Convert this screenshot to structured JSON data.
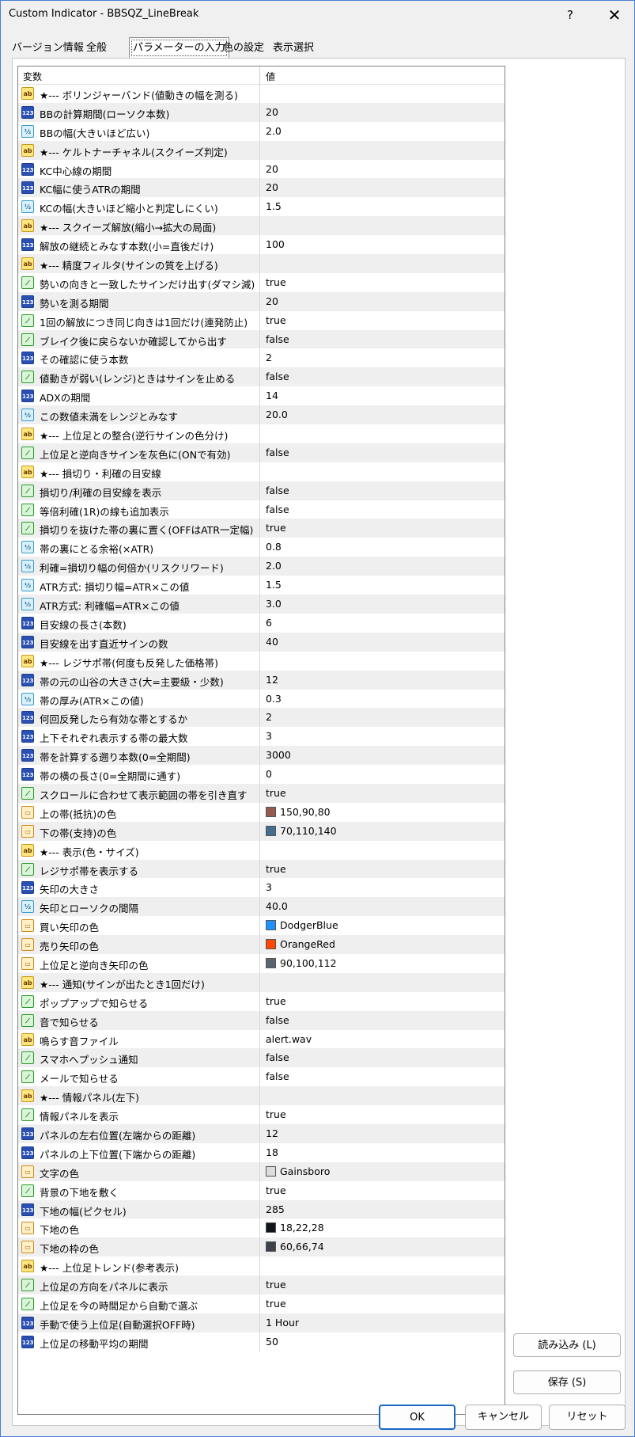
{
  "window": {
    "title": "Custom Indicator - BBSQZ_LineBreak",
    "help": "?",
    "close": "✕"
  },
  "tabs": [
    {
      "label": "バージョン情報"
    },
    {
      "label": "全般"
    },
    {
      "label": "パラメーターの入力"
    },
    {
      "label": "色の設定"
    },
    {
      "label": "表示選択"
    }
  ],
  "grid": {
    "col_variable": "変数",
    "col_value": "値"
  },
  "rows": [
    {
      "icon": "ab",
      "name": "★--- ボリンジャーバンド(値動きの幅を測る)",
      "value": ""
    },
    {
      "icon": "123",
      "name": "BBの計算期間(ローソク本数)",
      "value": "20"
    },
    {
      "icon": "half",
      "name": "BBの幅(大きいほど広い)",
      "value": "2.0"
    },
    {
      "icon": "ab",
      "name": "★--- ケルトナーチャネル(スクイーズ判定)",
      "value": ""
    },
    {
      "icon": "123",
      "name": "KC中心線の期間",
      "value": "20"
    },
    {
      "icon": "123",
      "name": "KC幅に使うATRの期間",
      "value": "20"
    },
    {
      "icon": "half",
      "name": "KCの幅(大きいほど縮小と判定しにくい)",
      "value": "1.5"
    },
    {
      "icon": "ab",
      "name": "★--- スクイーズ解放(縮小→拡大の局面)",
      "value": ""
    },
    {
      "icon": "123",
      "name": "解放の継続とみなす本数(小=直後だけ)",
      "value": "100"
    },
    {
      "icon": "ab",
      "name": "★--- 精度フィルタ(サインの質を上げる)",
      "value": ""
    },
    {
      "icon": "bool",
      "name": "勢いの向きと一致したサインだけ出す(ダマシ減)",
      "value": "true"
    },
    {
      "icon": "123",
      "name": "勢いを測る期間",
      "value": "20"
    },
    {
      "icon": "bool",
      "name": "1回の解放につき同じ向きは1回だけ(連発防止)",
      "value": "true"
    },
    {
      "icon": "bool",
      "name": "ブレイク後に戻らないか確認してから出す",
      "value": "false"
    },
    {
      "icon": "123",
      "name": "その確認に使う本数",
      "value": "2"
    },
    {
      "icon": "bool",
      "name": "値動きが弱い(レンジ)ときはサインを止める",
      "value": "false"
    },
    {
      "icon": "123",
      "name": "ADXの期間",
      "value": "14"
    },
    {
      "icon": "half",
      "name": "この数値未満をレンジとみなす",
      "value": "20.0"
    },
    {
      "icon": "ab",
      "name": "★--- 上位足との整合(逆行サインの色分け)",
      "value": ""
    },
    {
      "icon": "bool",
      "name": "上位足と逆向きサインを灰色に(ONで有効)",
      "value": "false"
    },
    {
      "icon": "ab",
      "name": "★--- 損切り・利確の目安線",
      "value": ""
    },
    {
      "icon": "bool",
      "name": "損切り/利確の目安線を表示",
      "value": "false"
    },
    {
      "icon": "bool",
      "name": "等倍利確(1R)の線も追加表示",
      "value": "false"
    },
    {
      "icon": "bool",
      "name": "損切りを抜けた帯の裏に置く(OFFはATR一定幅)",
      "value": "true"
    },
    {
      "icon": "half",
      "name": "帯の裏にとる余裕(×ATR)",
      "value": "0.8"
    },
    {
      "icon": "half",
      "name": "利確=損切り幅の何倍か(リスクリワード)",
      "value": "2.0"
    },
    {
      "icon": "half",
      "name": "ATR方式: 損切り幅=ATR×この値",
      "value": "1.5"
    },
    {
      "icon": "half",
      "name": "ATR方式: 利確幅=ATR×この値",
      "value": "3.0"
    },
    {
      "icon": "123",
      "name": "目安線の長さ(本数)",
      "value": "6"
    },
    {
      "icon": "123",
      "name": "目安線を出す直近サインの数",
      "value": "40"
    },
    {
      "icon": "ab",
      "name": "★--- レジサポ帯(何度も反発した価格帯)",
      "value": ""
    },
    {
      "icon": "123",
      "name": "帯の元の山谷の大きさ(大=主要級・少数)",
      "value": "12"
    },
    {
      "icon": "half",
      "name": "帯の厚み(ATR×この値)",
      "value": "0.3"
    },
    {
      "icon": "123",
      "name": "何回反発したら有効な帯とするか",
      "value": "2"
    },
    {
      "icon": "123",
      "name": "上下それぞれ表示する帯の最大数",
      "value": "3"
    },
    {
      "icon": "123",
      "name": "帯を計算する遡り本数(0=全期間)",
      "value": "3000"
    },
    {
      "icon": "123",
      "name": "帯の横の長さ(0=全期間に通す)",
      "value": "0"
    },
    {
      "icon": "bool",
      "name": "スクロールに合わせて表示範囲の帯を引き直す",
      "value": "true"
    },
    {
      "icon": "col",
      "name": "上の帯(抵抗)の色",
      "value": "150,90,80",
      "swatch": "#965a50"
    },
    {
      "icon": "col",
      "name": "下の帯(支持)の色",
      "value": "70,110,140",
      "swatch": "#466e8c"
    },
    {
      "icon": "ab",
      "name": "★--- 表示(色・サイズ)",
      "value": ""
    },
    {
      "icon": "bool",
      "name": "レジサポ帯を表示する",
      "value": "true"
    },
    {
      "icon": "123",
      "name": "矢印の大きさ",
      "value": "3"
    },
    {
      "icon": "half",
      "name": "矢印とローソクの間隔",
      "value": "40.0"
    },
    {
      "icon": "col",
      "name": "買い矢印の色",
      "value": "DodgerBlue",
      "swatch": "#1e90ff"
    },
    {
      "icon": "col",
      "name": "売り矢印の色",
      "value": "OrangeRed",
      "swatch": "#ff4500"
    },
    {
      "icon": "col",
      "name": "上位足と逆向き矢印の色",
      "value": "90,100,112",
      "swatch": "#5a6470"
    },
    {
      "icon": "ab",
      "name": "★--- 通知(サインが出たとき1回だけ)",
      "value": ""
    },
    {
      "icon": "bool",
      "name": "ポップアップで知らせる",
      "value": "true"
    },
    {
      "icon": "bool",
      "name": "音で知らせる",
      "value": "false"
    },
    {
      "icon": "ab",
      "name": "鳴らす音ファイル",
      "value": "alert.wav"
    },
    {
      "icon": "bool",
      "name": "スマホへプッシュ通知",
      "value": "false"
    },
    {
      "icon": "bool",
      "name": "メールで知らせる",
      "value": "false"
    },
    {
      "icon": "ab",
      "name": "★--- 情報パネル(左下)",
      "value": ""
    },
    {
      "icon": "bool",
      "name": "情報パネルを表示",
      "value": "true"
    },
    {
      "icon": "123",
      "name": "パネルの左右位置(左端からの距離)",
      "value": "12"
    },
    {
      "icon": "123",
      "name": "パネルの上下位置(下端からの距離)",
      "value": "18"
    },
    {
      "icon": "col",
      "name": "文字の色",
      "value": "Gainsboro",
      "swatch": "#dcdcdc"
    },
    {
      "icon": "bool",
      "name": "背景の下地を敷く",
      "value": "true"
    },
    {
      "icon": "123",
      "name": "下地の幅(ピクセル)",
      "value": "285"
    },
    {
      "icon": "col",
      "name": "下地の色",
      "value": "18,22,28",
      "swatch": "#12161c"
    },
    {
      "icon": "col",
      "name": "下地の枠の色",
      "value": "60,66,74",
      "swatch": "#3c424a"
    },
    {
      "icon": "ab",
      "name": "★--- 上位足トレンド(参考表示)",
      "value": ""
    },
    {
      "icon": "bool",
      "name": "上位足の方向をパネルに表示",
      "value": "true"
    },
    {
      "icon": "bool",
      "name": "上位足を今の時間足から自動で選ぶ",
      "value": "true"
    },
    {
      "icon": "123",
      "name": "手動で使う上位足(自動選択OFF時)",
      "value": "1 Hour"
    },
    {
      "icon": "123",
      "name": "上位足の移動平均の期間",
      "value": "50"
    }
  ],
  "buttons": {
    "load": "読み込み (L)",
    "save": "保存 (S)",
    "ok": "OK",
    "cancel": "キャンセル",
    "reset": "リセット"
  }
}
